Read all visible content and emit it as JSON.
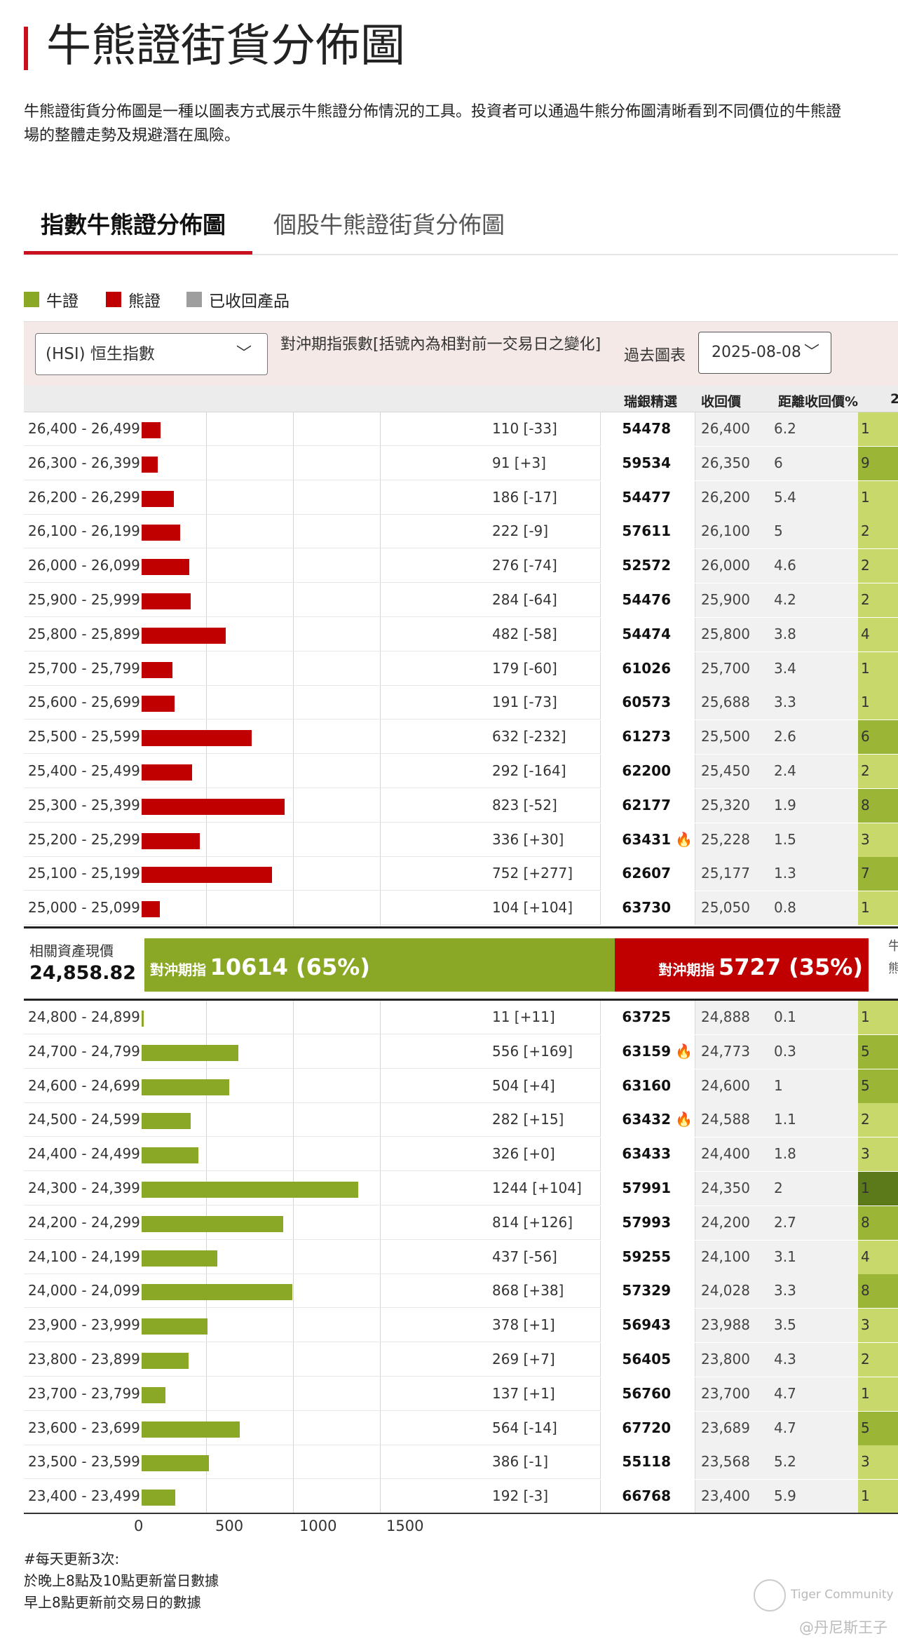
{
  "page": {
    "title": "牛熊證街貨分佈圖",
    "description_line1": "牛熊證街貨分佈圖是一種以圖表方式展示牛熊證分佈情況的工具。投資者可以通過牛熊分佈圖清晰看到不同價位的牛熊證",
    "description_line2": "場的整體走勢及規避潛在風險。"
  },
  "tabs": [
    {
      "label": "指數牛熊證分佈圖",
      "active": true
    },
    {
      "label": "個股牛熊證街貨分佈圖",
      "active": false
    }
  ],
  "legend": [
    {
      "label": "牛證",
      "color": "#8aa825"
    },
    {
      "label": "熊證",
      "color": "#c00000"
    },
    {
      "label": "已收回產品",
      "color": "#9e9e9e"
    }
  ],
  "controls": {
    "index_select": "(HSI) 恒生指數",
    "hedge_header": "對沖期指張數[括號內為相對前一交易日之變化]",
    "past_chart_label": "過去圖表",
    "date_select": "2025-08-08"
  },
  "columns": {
    "issuer": "瑞銀精選",
    "call_price": "收回價",
    "distance": "距離收回價%",
    "extra": "2"
  },
  "bear_rows": [
    {
      "range": "26,400 - 26,499",
      "value": 110,
      "change": "110 [-33]",
      "code": "54478",
      "hot": false,
      "call": "26,400",
      "dist": "6.2",
      "ext": "1"
    },
    {
      "range": "26,300 - 26,399",
      "value": 91,
      "change": "91 [+3]",
      "code": "59534",
      "hot": false,
      "call": "26,350",
      "dist": "6",
      "ext": "9"
    },
    {
      "range": "26,200 - 26,299",
      "value": 186,
      "change": "186 [-17]",
      "code": "54477",
      "hot": false,
      "call": "26,200",
      "dist": "5.4",
      "ext": "1"
    },
    {
      "range": "26,100 - 26,199",
      "value": 222,
      "change": "222 [-9]",
      "code": "57611",
      "hot": false,
      "call": "26,100",
      "dist": "5",
      "ext": "2"
    },
    {
      "range": "26,000 - 26,099",
      "value": 276,
      "change": "276 [-74]",
      "code": "52572",
      "hot": false,
      "call": "26,000",
      "dist": "4.6",
      "ext": "2"
    },
    {
      "range": "25,900 - 25,999",
      "value": 284,
      "change": "284 [-64]",
      "code": "54476",
      "hot": false,
      "call": "25,900",
      "dist": "4.2",
      "ext": "2"
    },
    {
      "range": "25,800 - 25,899",
      "value": 482,
      "change": "482 [-58]",
      "code": "54474",
      "hot": false,
      "call": "25,800",
      "dist": "3.8",
      "ext": "4"
    },
    {
      "range": "25,700 - 25,799",
      "value": 179,
      "change": "179 [-60]",
      "code": "61026",
      "hot": false,
      "call": "25,700",
      "dist": "3.4",
      "ext": "1"
    },
    {
      "range": "25,600 - 25,699",
      "value": 191,
      "change": "191 [-73]",
      "code": "60573",
      "hot": false,
      "call": "25,688",
      "dist": "3.3",
      "ext": "1"
    },
    {
      "range": "25,500 - 25,599",
      "value": 632,
      "change": "632 [-232]",
      "code": "61273",
      "hot": false,
      "call": "25,500",
      "dist": "2.6",
      "ext": "6"
    },
    {
      "range": "25,400 - 25,499",
      "value": 292,
      "change": "292 [-164]",
      "code": "62200",
      "hot": false,
      "call": "25,450",
      "dist": "2.4",
      "ext": "2"
    },
    {
      "range": "25,300 - 25,399",
      "value": 823,
      "change": "823 [-52]",
      "code": "62177",
      "hot": false,
      "call": "25,320",
      "dist": "1.9",
      "ext": "8"
    },
    {
      "range": "25,200 - 25,299",
      "value": 336,
      "change": "336 [+30]",
      "code": "63431",
      "hot": true,
      "call": "25,228",
      "dist": "1.5",
      "ext": "3"
    },
    {
      "range": "25,100 - 25,199",
      "value": 752,
      "change": "752 [+277]",
      "code": "62607",
      "hot": false,
      "call": "25,177",
      "dist": "1.3",
      "ext": "7"
    },
    {
      "range": "25,000 - 25,099",
      "value": 104,
      "change": "104 [+104]",
      "code": "63730",
      "hot": false,
      "call": "25,050",
      "dist": "0.8",
      "ext": "1"
    }
  ],
  "summary": {
    "asset_label": "相關資產現價",
    "asset_value": "24,858.82",
    "bull_prefix": "對沖期指",
    "bull_value": "10614 (65%)",
    "bull_pct": 65,
    "bear_prefix": "對沖期指",
    "bear_value": "5727 (35%)",
    "bear_pct": 35,
    "right_a": "牛",
    "right_b": "熊"
  },
  "bull_rows": [
    {
      "range": "24,800 - 24,899",
      "value": 11,
      "change": "11 [+11]",
      "code": "63725",
      "hot": false,
      "call": "24,888",
      "dist": "0.1",
      "ext": "1"
    },
    {
      "range": "24,700 - 24,799",
      "value": 556,
      "change": "556 [+169]",
      "code": "63159",
      "hot": true,
      "call": "24,773",
      "dist": "0.3",
      "ext": "5"
    },
    {
      "range": "24,600 - 24,699",
      "value": 504,
      "change": "504 [+4]",
      "code": "63160",
      "hot": false,
      "call": "24,600",
      "dist": "1",
      "ext": "5"
    },
    {
      "range": "24,500 - 24,599",
      "value": 282,
      "change": "282 [+15]",
      "code": "63432",
      "hot": true,
      "call": "24,588",
      "dist": "1.1",
      "ext": "2"
    },
    {
      "range": "24,400 - 24,499",
      "value": 326,
      "change": "326 [+0]",
      "code": "63433",
      "hot": false,
      "call": "24,400",
      "dist": "1.8",
      "ext": "3"
    },
    {
      "range": "24,300 - 24,399",
      "value": 1244,
      "change": "1244 [+104]",
      "code": "57991",
      "hot": false,
      "call": "24,350",
      "dist": "2",
      "ext": "1"
    },
    {
      "range": "24,200 - 24,299",
      "value": 814,
      "change": "814 [+126]",
      "code": "57993",
      "hot": false,
      "call": "24,200",
      "dist": "2.7",
      "ext": "8"
    },
    {
      "range": "24,100 - 24,199",
      "value": 437,
      "change": "437 [-56]",
      "code": "59255",
      "hot": false,
      "call": "24,100",
      "dist": "3.1",
      "ext": "4"
    },
    {
      "range": "24,000 - 24,099",
      "value": 868,
      "change": "868 [+38]",
      "code": "57329",
      "hot": false,
      "call": "24,028",
      "dist": "3.3",
      "ext": "8"
    },
    {
      "range": "23,900 - 23,999",
      "value": 378,
      "change": "378 [+1]",
      "code": "56943",
      "hot": false,
      "call": "23,988",
      "dist": "3.5",
      "ext": "3"
    },
    {
      "range": "23,800 - 23,899",
      "value": 269,
      "change": "269 [+7]",
      "code": "56405",
      "hot": false,
      "call": "23,800",
      "dist": "4.3",
      "ext": "2"
    },
    {
      "range": "23,700 - 23,799",
      "value": 137,
      "change": "137 [+1]",
      "code": "56760",
      "hot": false,
      "call": "23,700",
      "dist": "4.7",
      "ext": "1"
    },
    {
      "range": "23,600 - 23,699",
      "value": 564,
      "change": "564 [-14]",
      "code": "67720",
      "hot": false,
      "call": "23,689",
      "dist": "4.7",
      "ext": "5"
    },
    {
      "range": "23,500 - 23,599",
      "value": 386,
      "change": "386 [-1]",
      "code": "55118",
      "hot": false,
      "call": "23,568",
      "dist": "5.2",
      "ext": "3"
    },
    {
      "range": "23,400 - 23,499",
      "value": 192,
      "change": "192 [-3]",
      "code": "66768",
      "hot": false,
      "call": "23,400",
      "dist": "5.9",
      "ext": "1"
    }
  ],
  "axis": {
    "ticks": [
      "0",
      "500",
      "1000",
      "1500"
    ],
    "max": 2000
  },
  "footer": {
    "line1": "#每天更新3次:",
    "line2": "於晚上8點及10點更新當日數據",
    "line3": "早上8點更新前交易日的數據"
  },
  "watermark": {
    "community": "Tiger Community",
    "author": "@丹尼斯王子"
  }
}
